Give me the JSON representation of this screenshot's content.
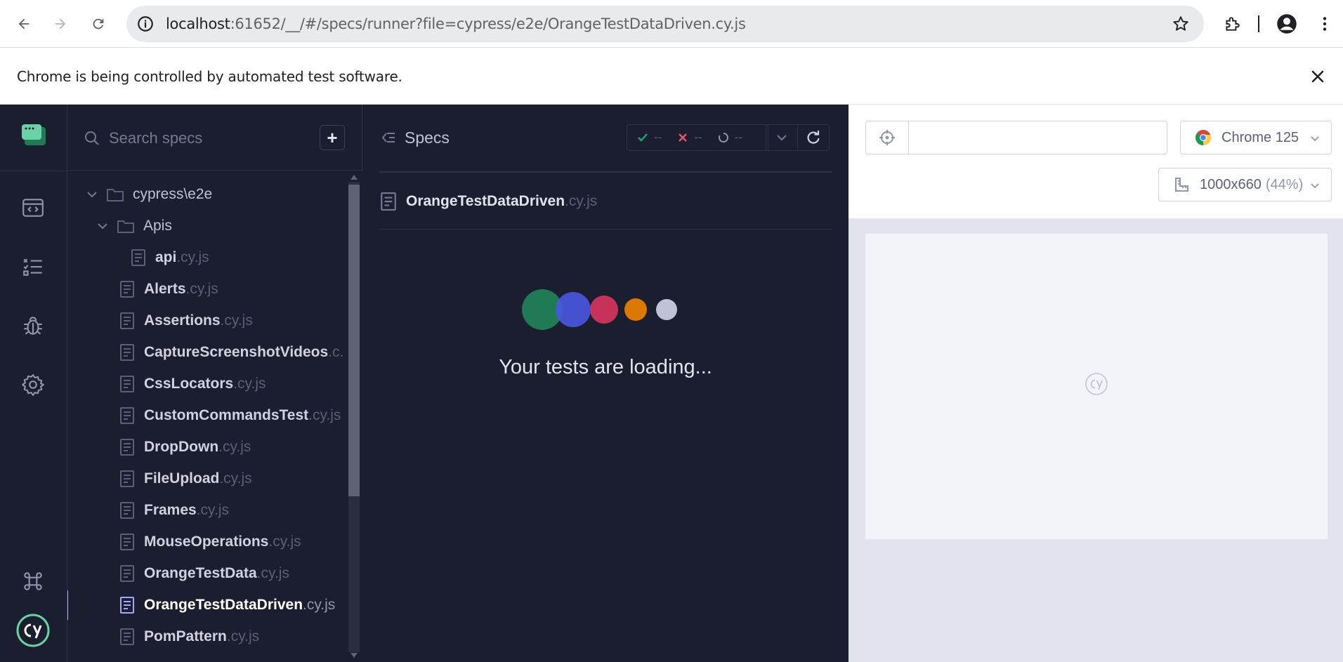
{
  "browser": {
    "url_host": "localhost",
    "url_rest": ":61652/__/#/specs/runner?file=cypress/e2e/OrangeTestDataDriven.cy.js",
    "infobar_message": "Chrome is being controlled by automated test software."
  },
  "specs_panel": {
    "search_placeholder": "Search specs",
    "add_label": "+",
    "tree": [
      {
        "type": "dir",
        "label": "cypress\\e2e"
      },
      {
        "type": "dir",
        "label": "Apis"
      },
      {
        "type": "file",
        "name": "api",
        "ext": ".cy.js"
      },
      {
        "type": "file",
        "name": "Alerts",
        "ext": ".cy.js"
      },
      {
        "type": "file",
        "name": "Assertions",
        "ext": ".cy.js"
      },
      {
        "type": "file",
        "name": "CaptureScreenshotVideos",
        "ext": ".c..."
      },
      {
        "type": "file",
        "name": "CssLocators",
        "ext": ".cy.js"
      },
      {
        "type": "file",
        "name": "CustomCommandsTest",
        "ext": ".cy.js"
      },
      {
        "type": "file",
        "name": "DropDown",
        "ext": ".cy.js"
      },
      {
        "type": "file",
        "name": "FileUpload",
        "ext": ".cy.js"
      },
      {
        "type": "file",
        "name": "Frames",
        "ext": ".cy.js"
      },
      {
        "type": "file",
        "name": "MouseOperations",
        "ext": ".cy.js"
      },
      {
        "type": "file",
        "name": "OrangeTestData",
        "ext": ".cy.js"
      },
      {
        "type": "file",
        "name": "OrangeTestDataDriven",
        "ext": ".cy.js",
        "active": true
      },
      {
        "type": "file",
        "name": "PomPattern",
        "ext": ".cy.js"
      }
    ]
  },
  "reporter": {
    "title": "Specs",
    "passed": "--",
    "failed": "--",
    "pending": "--",
    "spec_name": "OrangeTestDataDriven",
    "spec_ext": ".cy.js",
    "loading_text": "Your tests are loading...",
    "loader_colors": [
      "#1f7a55",
      "#4956e3",
      "#c6325a",
      "#db7903",
      "#c0c3d8"
    ]
  },
  "aut": {
    "browser_label": "Chrome 125",
    "viewport_label": "1000x660",
    "viewport_pct": "(44%)",
    "url_value": ""
  },
  "colors": {
    "app_bg": "#1b1e2e",
    "accent": "#a3a8f8",
    "passed": "#1fa971",
    "failed": "#e45770"
  }
}
